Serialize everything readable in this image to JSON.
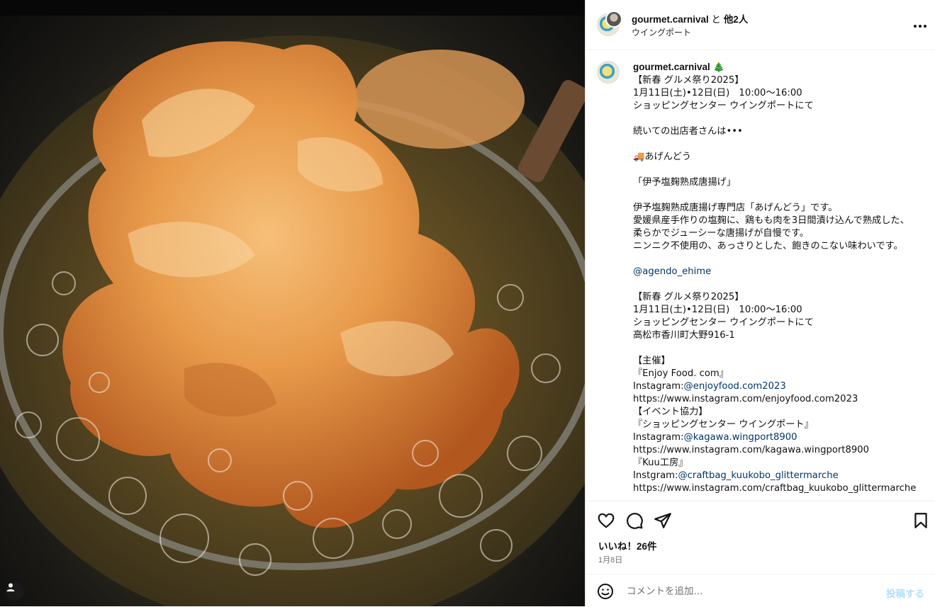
{
  "header": {
    "account": "gourmet.carnival",
    "connector": " と ",
    "others": "他2人",
    "location": "ウイングポート",
    "more_icon": "more-horizontal-icon"
  },
  "caption": {
    "author": "gourmet.carnival",
    "lines": [
      "【新春 グルメ祭り2025】",
      "1月11日(土)•12日(日)　10:00〜16:00",
      "ショッピングセンター ウイングポートにて",
      "",
      "続いての出店者さんは•••",
      "",
      "🚚あげんどう",
      "",
      "「伊予塩麹熟成唐揚げ」",
      "",
      "伊予塩麹熟成唐揚げ専門店「あげんどう」です。",
      "愛媛県産手作りの塩麹に、鶏もも肉を3日間漬け込んで熟成した、柔らかでジューシーな唐揚げが自慢です。",
      "ニンニク不使用の、あっさりとした、飽きのこない味わいです。",
      "",
      "@agendo_ehime",
      "",
      "【新春 グルメ祭り2025】",
      "1月11日(土)•12日(日)　10:00〜16:00",
      "ショッピングセンター ウイングポートにて",
      "高松市香川町大野916-1",
      "",
      "【主催】",
      "『Enjoy Food. com』",
      "Instagram:@enjoyfood.com2023",
      "https://www.instagram.com/enjoyfood.com2023",
      "【イベント協力】",
      "『ショッピングセンター ウイングポート』",
      "Instagram:@kagawa.wingport8900",
      "https://www.instagram.com/kagawa.wingport8900",
      "『Kuu工房』",
      "Instgram:@craftbag_kuukobo_glittermarche",
      "https://www.instagram.com/craftbag_kuukobo_glittermarche"
    ]
  },
  "engagement": {
    "likes": "いいね！26件",
    "date": "1月8日"
  },
  "composer": {
    "placeholder": "コメントを追加...",
    "post_label": "投稿する"
  },
  "colors": {
    "link": "#00376b",
    "post_disabled": "#b2dffc",
    "muted": "#737373"
  },
  "icons": [
    "like-icon",
    "comment-icon",
    "share-icon",
    "save-icon",
    "emoji-icon",
    "user-tag-icon"
  ]
}
